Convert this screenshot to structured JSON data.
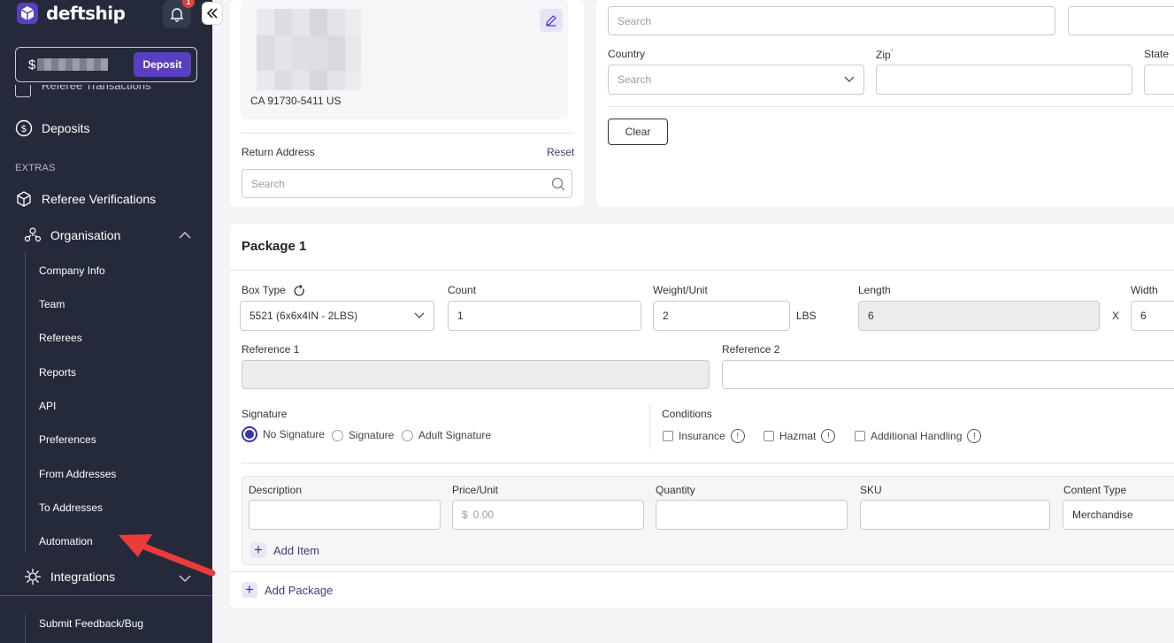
{
  "app": {
    "name": "deftship",
    "notification_count": "1"
  },
  "balance": {
    "currency_symbol": "$",
    "deposit_label": "Deposit"
  },
  "sidebar": {
    "cut_item": "Referee Transactions",
    "deposits": "Deposits",
    "extras_label": "EXTRAS",
    "referee_verifications": "Referee Verifications",
    "organisation": "Organisation",
    "org_items": [
      "Company Info",
      "Team",
      "Referees",
      "Reports",
      "API",
      "Preferences",
      "From Addresses",
      "To Addresses",
      "Automation"
    ],
    "integrations": "Integrations",
    "feedback": "Submit Feedback/Bug"
  },
  "address_card": {
    "line": "CA 91730-5411 US",
    "return_label": "Return Address",
    "reset_label": "Reset",
    "search_placeholder": "Search"
  },
  "filter_card": {
    "search_placeholder": "Search",
    "country_label": "Country",
    "country_placeholder": "Search",
    "zip_label": "Zip",
    "zip_required": "*",
    "state_label": "State",
    "clear_label": "Clear"
  },
  "package": {
    "title": "Package 1",
    "box_type_label": "Box Type",
    "box_type_value": "5521 (6x6x4IN - 2LBS)",
    "count_label": "Count",
    "count_value": "1",
    "weight_label": "Weight/Unit",
    "weight_value": "2",
    "weight_unit": "LBS",
    "length_label": "Length",
    "length_value": "6",
    "times": "X",
    "width_label": "Width",
    "width_value": "6",
    "ref1_label": "Reference 1",
    "ref2_label": "Reference 2",
    "signature_label": "Signature",
    "signature_options": [
      "No Signature",
      "Signature",
      "Adult Signature"
    ],
    "conditions_label": "Conditions",
    "conditions": [
      "Insurance",
      "Hazmat",
      "Additional Handling"
    ],
    "info_glyph": "!",
    "items_headers": {
      "description": "Description",
      "price": "Price/Unit",
      "quantity": "Quantity",
      "sku": "SKU",
      "content_type": "Content Type"
    },
    "price_prefix": "$",
    "price_placeholder": "0.00",
    "content_type_value": "Merchandise",
    "add_item": "Add Item",
    "add_package": "Add Package"
  }
}
